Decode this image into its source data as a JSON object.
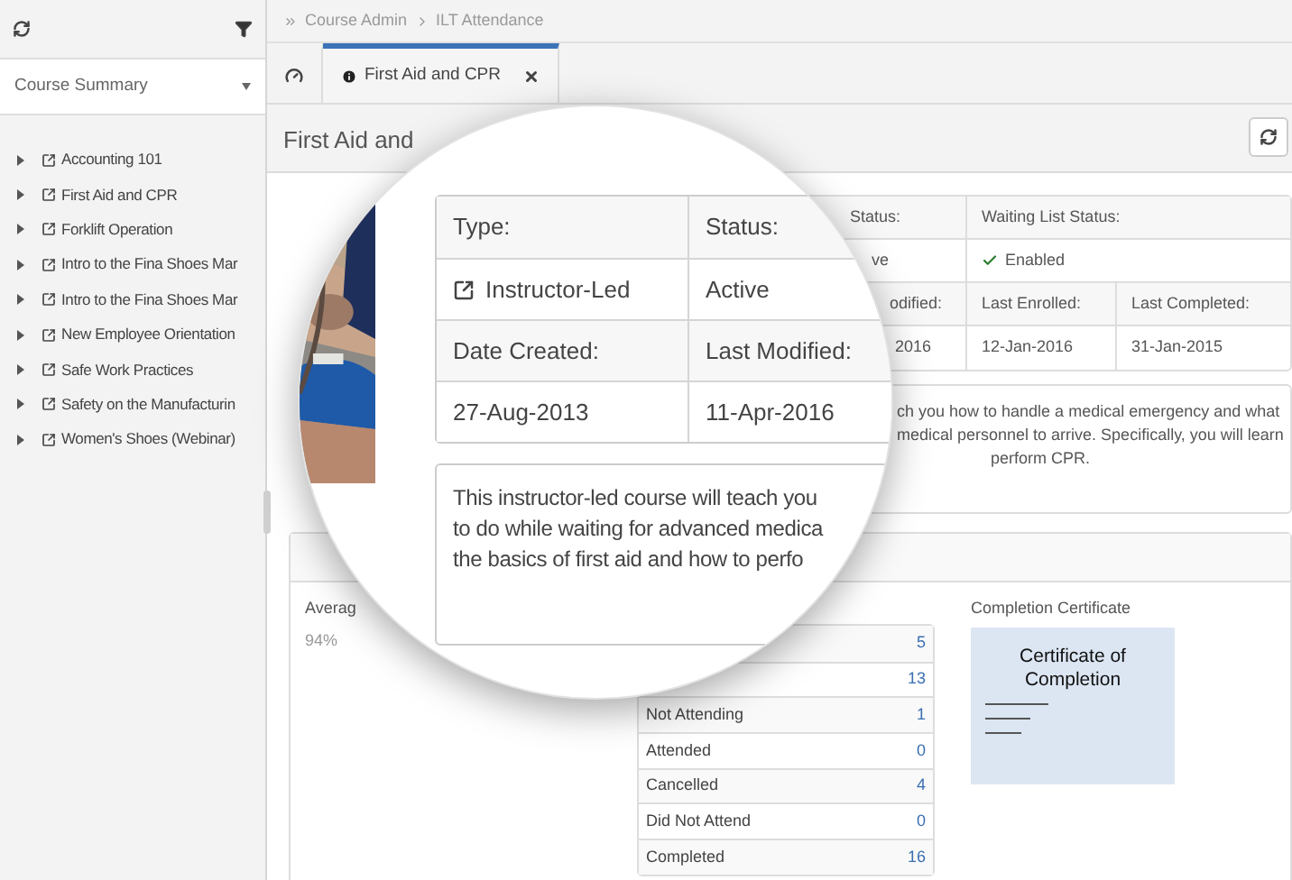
{
  "sidebar": {
    "course_select": {
      "value": "Course Summary"
    },
    "courses": [
      {
        "name": "Accounting 101",
        "expanded": false
      },
      {
        "name": "First Aid and CPR",
        "expanded": false
      },
      {
        "name": "Forklift Operation",
        "expanded": false
      },
      {
        "name": "Intro to the Fina Shoes Mar",
        "expanded": false
      },
      {
        "name": "Intro to the Fina Shoes Mar",
        "expanded": false
      },
      {
        "name": "New Employee Orientation",
        "expanded": false
      },
      {
        "name": "Safe Work Practices",
        "expanded": false
      },
      {
        "name": "Safety on the Manufacturin",
        "expanded": false
      },
      {
        "name": "Women's Shoes (Webinar)",
        "expanded": false
      }
    ]
  },
  "breadcrumb": [
    "Course Admin",
    "ILT Attendance"
  ],
  "tabs": [
    {
      "kind": "dashboard",
      "selected": false
    },
    {
      "kind": "course",
      "label": "First Aid and CPR",
      "selected": true
    }
  ],
  "title": "First Aid and",
  "details": {
    "status_label": "Status:",
    "waiting_list_label": "Waiting List Status:",
    "status_value": "ve",
    "waiting_list_value": "Enabled",
    "waiting_list_enabled": true,
    "modified_label": "odified:",
    "enrolled_label": "Last Enrolled:",
    "completed_label": "Last Completed:",
    "modified_value": "2016",
    "enrolled_value": "12-Jan-2016",
    "completed_value": "31-Jan-2015"
  },
  "description_lines": [
    "ch you how to handle a medical emergency and what",
    "medical personnel to arrive. Specifically, you will learn",
    "perform CPR."
  ],
  "statistics": {
    "average_label": "Averag",
    "average_value": "94%",
    "counts": [
      {
        "value": "5"
      },
      {
        "value": "13"
      },
      {
        "label": "Not Attending",
        "value": "1"
      },
      {
        "label": "Attended",
        "value": "0"
      },
      {
        "label": "Cancelled",
        "value": "4"
      },
      {
        "label": "Did Not Attend",
        "value": "0"
      },
      {
        "label": "Completed",
        "value": "16"
      }
    ],
    "certificate": {
      "label": "Completion Certificate",
      "title": "Certificate of Completion"
    }
  },
  "magnifier": {
    "rows": [
      [
        {
          "kind": "label",
          "text": "Type:"
        },
        {
          "kind": "label",
          "text": "Status:"
        }
      ],
      [
        {
          "kind": "type",
          "text": "Instructor-Led"
        },
        {
          "kind": "value",
          "text": "Active"
        }
      ],
      [
        {
          "kind": "label",
          "text": "Date Created:"
        },
        {
          "kind": "label",
          "text": "Last Modified:"
        }
      ],
      [
        {
          "kind": "value",
          "text": "27-Aug-2013"
        },
        {
          "kind": "value",
          "text": "11-Apr-2016"
        }
      ]
    ],
    "description_lines": [
      "This instructor-led course will teach you",
      "to do while waiting for advanced medica",
      "the basics of first aid and how to perfo"
    ]
  }
}
